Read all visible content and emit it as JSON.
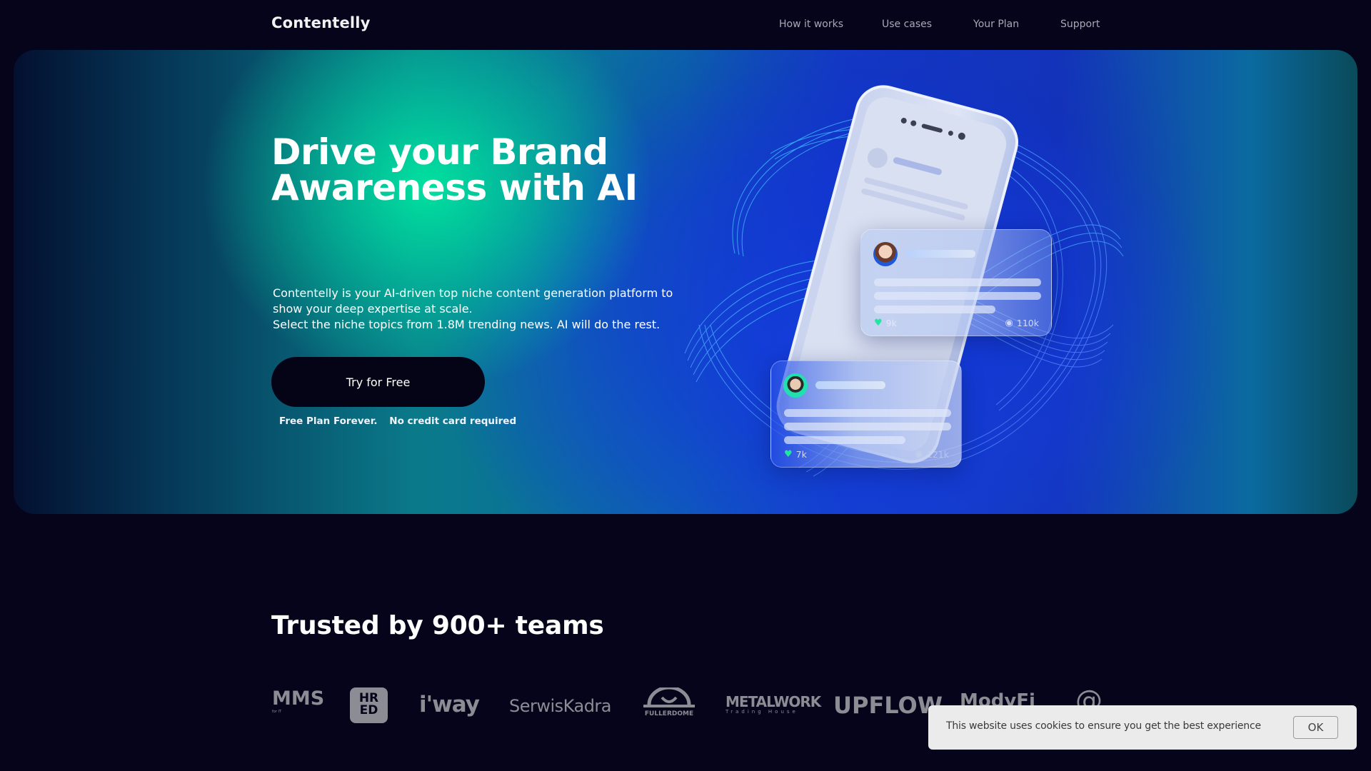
{
  "header": {
    "logo": "Contentelly",
    "nav": [
      {
        "label": "How it works"
      },
      {
        "label": "Use cases"
      },
      {
        "label": "Your Plan"
      },
      {
        "label": "Support"
      }
    ]
  },
  "hero": {
    "title_line1": "Drive your Brand",
    "title_line2": "Awareness with AI",
    "description": [
      "Contentelly is your AI-driven top niche content generation platform to",
      "show your deep expertise at scale.",
      "Select the niche topics from 1.8M trending news. AI will do the rest."
    ],
    "cta_label": "Try for Free",
    "notes": [
      "Free Plan Forever.",
      "No credit card required"
    ],
    "illustration": {
      "cards": [
        {
          "avatar": "woman-avatar",
          "likes": "9k",
          "views": "110k"
        },
        {
          "avatar": "man-avatar",
          "likes": "7k",
          "views": "121k"
        }
      ],
      "colors": {
        "heart": "#20e6a0"
      }
    }
  },
  "trusted": {
    "title": "Trusted by 900+ teams",
    "logos": [
      {
        "name": "MMS",
        "sub": "for IT"
      },
      {
        "name": "HR ED",
        "line1": "HR",
        "line2": "ED"
      },
      {
        "name": "i'way"
      },
      {
        "name": "SerwisKadra"
      },
      {
        "name": "FULLERDOME"
      },
      {
        "name": "METALWORK",
        "sub": "Trading House"
      },
      {
        "name": "UPFLOW"
      },
      {
        "name": "ModyFi"
      },
      {
        "name": "@"
      }
    ]
  },
  "cookie": {
    "text": "This website uses cookies to ensure you get the best experience",
    "ok_label": "OK"
  },
  "colors": {
    "page_bg": "#05041a",
    "button_bg": "#050417",
    "accent_green": "#00e6a0",
    "accent_blue": "#1540c8",
    "logo_gray": "#8c8c94",
    "cookie_bg": "#ebebeb"
  }
}
